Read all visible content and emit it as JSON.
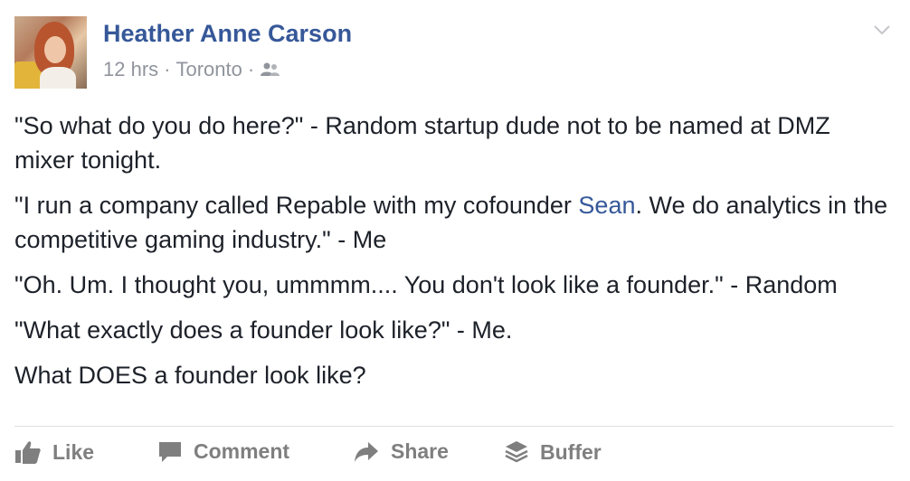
{
  "post": {
    "author": "Heather Anne Carson",
    "time": "12 hrs",
    "location": "Toronto",
    "separator": "·",
    "privacy_icon": "friends-icon",
    "body": {
      "p1": "\"So what do you do here?\" - Random startup dude not to be named at DMZ mixer tonight.",
      "p2_before": "\"I run a company called Repable with my cofounder ",
      "p2_link": "Sean",
      "p2_after": ". We do analytics in the competitive gaming industry.\" - Me",
      "p3": "\"Oh. Um. I thought you, ummmm.... You don't look like a founder.\" - Random",
      "p4": "\"What exactly does a founder look like?\" - Me.",
      "p5": "What DOES a founder look like?"
    }
  },
  "actions": {
    "like": "Like",
    "comment": "Comment",
    "share": "Share",
    "buffer": "Buffer"
  },
  "colors": {
    "link": "#365899",
    "meta": "#90949c",
    "action": "#7f7f7f"
  }
}
